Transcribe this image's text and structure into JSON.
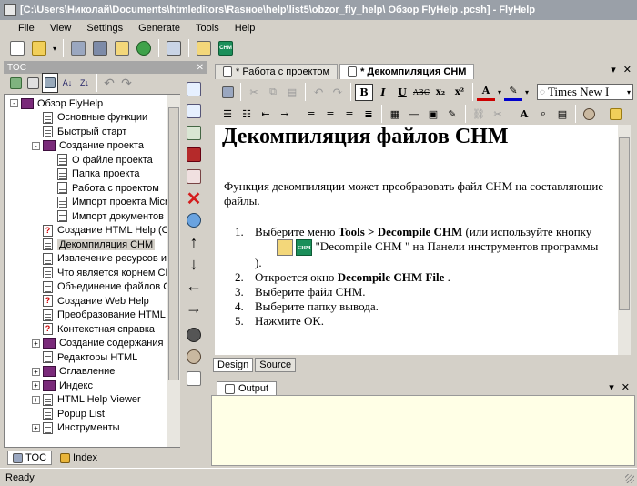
{
  "window": {
    "title": "[C:\\Users\\Николай\\Documents\\htmleditors\\Rasное\\help\\list5\\obzor_fly_help\\ Обзор FlyHelp .pcsh] - FlyHelp"
  },
  "menu": [
    "File",
    "View",
    "Settings",
    "Generate",
    "Tools",
    "Help"
  ],
  "toc": {
    "header": "TOC",
    "items": [
      {
        "label": "Обзор FlyHelp",
        "icon": "book-icon",
        "level": 0,
        "expander": "-"
      },
      {
        "label": "Основные функции",
        "icon": "page-icon",
        "level": 1
      },
      {
        "label": "Быстрый старт",
        "icon": "page-icon",
        "level": 1
      },
      {
        "label": "Создание проекта",
        "icon": "book-icon",
        "level": 1,
        "expander": "-"
      },
      {
        "label": "О файле проекта",
        "icon": "page-icon",
        "level": 2
      },
      {
        "label": "Папка проекта",
        "icon": "page-icon",
        "level": 2
      },
      {
        "label": "Работа с проектом",
        "icon": "page-icon",
        "level": 2
      },
      {
        "label": "Импорт проекта Micro",
        "icon": "page-icon",
        "level": 2
      },
      {
        "label": "Импорт документов M",
        "icon": "page-icon",
        "level": 2
      },
      {
        "label": "Создание HTML Help (CH",
        "icon": "question-page-icon",
        "level": 1
      },
      {
        "label": "Декомпиляция CHM",
        "icon": "page-icon",
        "level": 1,
        "selected": true
      },
      {
        "label": "Извлечение ресурсов из C",
        "icon": "page-icon",
        "level": 1
      },
      {
        "label": "Что является корнем CHM",
        "icon": "page-icon",
        "level": 1
      },
      {
        "label": "Объединение файлов CH",
        "icon": "page-icon",
        "level": 1
      },
      {
        "label": "Создание Web Help",
        "icon": "question-page-icon",
        "level": 1
      },
      {
        "label": "Преобразование HTML H",
        "icon": "page-icon",
        "level": 1
      },
      {
        "label": "Контекстная справка",
        "icon": "question-page-icon",
        "level": 1
      },
      {
        "label": "Создание содержания сп",
        "icon": "book-icon",
        "level": 1,
        "expander": "+"
      },
      {
        "label": "Редакторы HTML",
        "icon": "page-icon",
        "level": 1
      },
      {
        "label": "Оглавление",
        "icon": "book-icon",
        "level": 1,
        "expander": "+"
      },
      {
        "label": "Индекс",
        "icon": "book-icon",
        "level": 1,
        "expander": "+"
      },
      {
        "label": "HTML Help Viewer",
        "icon": "page-icon",
        "level": 1,
        "expander": "+"
      },
      {
        "label": "Popup List",
        "icon": "page-icon",
        "level": 1
      },
      {
        "label": "Инструменты",
        "icon": "page-icon",
        "level": 1,
        "expander": "+"
      }
    ],
    "tabs": [
      {
        "label": "TOC",
        "active": true
      },
      {
        "label": "Index",
        "active": false
      }
    ]
  },
  "editor": {
    "tabs": [
      {
        "label": "* Работа с проектом",
        "active": false
      },
      {
        "label": "* Декомпиляция CHM",
        "active": true
      }
    ],
    "font": "Times New I",
    "heading": "Декомпиляция файлов CHM",
    "intro": "Функция декомпиляции может  преобразовать файл CHM на составляющие файлы.",
    "steps": [
      {
        "n": "1.",
        "pre": "Выберите меню ",
        "bold": "Tools > Decompile CHM",
        "post": " (или используйте кнопку",
        "btn_text": "\"Decompile CHM \"  на Панели инструментов программы )."
      },
      {
        "n": "2.",
        "pre": "Откроется окно ",
        "bold": "Decompile CHM File",
        "post": " ."
      },
      {
        "n": "3.",
        "pre": "Выберите файл CHM.",
        "bold": "",
        "post": ""
      },
      {
        "n": "4.",
        "pre": "Выберите папку вывода.",
        "bold": "",
        "post": ""
      },
      {
        "n": "5.",
        "pre": "Нажмите OK.",
        "bold": "",
        "post": ""
      }
    ],
    "mode_tabs": [
      {
        "label": "Design",
        "active": true
      },
      {
        "label": "Source",
        "active": false
      }
    ]
  },
  "output": {
    "tab": "Output"
  },
  "status": {
    "text": "Ready"
  },
  "colors": {
    "book": "#7a2a7a",
    "chm_icon_bg": "#1b8f5a",
    "output_bg": "#ffffe6"
  }
}
